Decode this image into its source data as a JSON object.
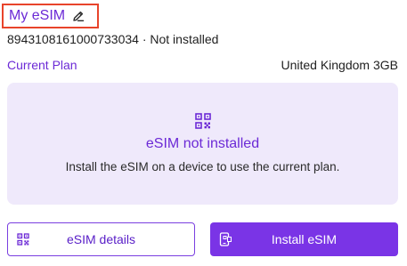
{
  "header": {
    "title": "My eSIM",
    "subtitle": "8943108161000733034 · Not installed"
  },
  "plan": {
    "label": "Current Plan",
    "value": "United Kingdom 3GB"
  },
  "status": {
    "title": "eSIM not installed",
    "description": "Install the eSIM on a device to use the current plan."
  },
  "actions": {
    "details_label": "eSIM details",
    "install_label": "Install eSIM"
  },
  "colors": {
    "accent": "#6c2ad6",
    "panel": "#efe9fb",
    "highlight_border": "#e8442b"
  },
  "icons": {
    "edit": "pencil-edit-icon",
    "qr": "qr-code-icon",
    "install": "device-install-icon"
  }
}
